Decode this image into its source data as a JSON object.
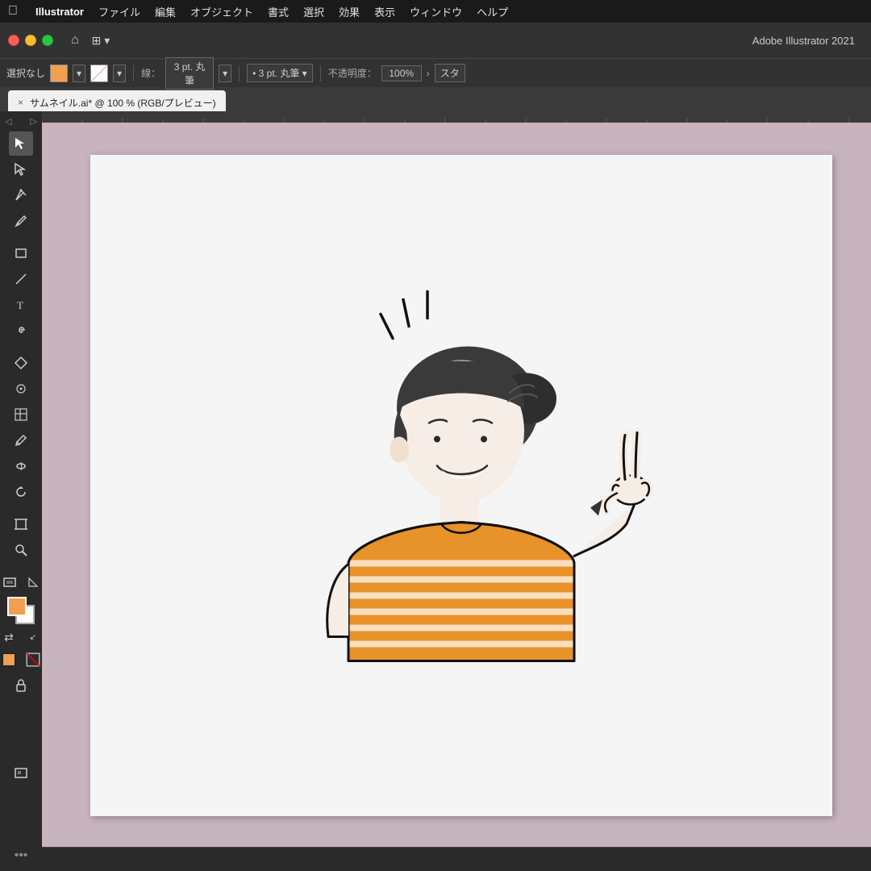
{
  "menubar": {
    "apple": "&#xF8FF;",
    "items": [
      {
        "label": "Illustrator",
        "bold": true
      },
      {
        "label": "ファイル"
      },
      {
        "label": "編集"
      },
      {
        "label": "オブジェクト"
      },
      {
        "label": "書式"
      },
      {
        "label": "選択"
      },
      {
        "label": "効果"
      },
      {
        "label": "表示"
      },
      {
        "label": "ウィンドウ"
      },
      {
        "label": "ヘルプ"
      }
    ]
  },
  "toolbar": {
    "app_title": "Adobe Illustrator 2021"
  },
  "optionsbar": {
    "selection_label": "選択なし",
    "stroke_label": "線：",
    "stroke_value": "3 pt. 丸筆",
    "opacity_label": "不透明度：",
    "opacity_value": "100%",
    "style_label": "スタ"
  },
  "tabbar": {
    "tab_label": "サムネイル.ai* @ 100 % (RGB/プレビュー)",
    "close_symbol": "×"
  },
  "tools": [
    {
      "name": "select-tool",
      "icon": "▲",
      "tooltip": "選択ツール"
    },
    {
      "name": "direct-select-tool",
      "icon": "↗",
      "tooltip": "ダイレクト選択ツール"
    },
    {
      "name": "pen-tool",
      "icon": "✒",
      "tooltip": "ペンツール"
    },
    {
      "name": "pencil-tool",
      "icon": "✏",
      "tooltip": "鉛筆ツール"
    },
    {
      "name": "rectangle-tool",
      "icon": "▭",
      "tooltip": "長方形ツール"
    },
    {
      "name": "line-tool",
      "icon": "╱",
      "tooltip": "直線ツール"
    },
    {
      "name": "text-tool",
      "icon": "T",
      "tooltip": "文字ツール"
    },
    {
      "name": "spiral-tool",
      "icon": "◎",
      "tooltip": "スパイラルツール"
    },
    {
      "name": "gradient-tool",
      "icon": "◆",
      "tooltip": "グラデーションツール"
    },
    {
      "name": "mesh-tool",
      "icon": "⊕",
      "tooltip": "メッシュツール"
    },
    {
      "name": "shape-builder-tool",
      "icon": "▣",
      "tooltip": "シェイプ形成ツール"
    },
    {
      "name": "eyedropper-tool",
      "icon": "⌗",
      "tooltip": "スポイトツール"
    },
    {
      "name": "warp-tool",
      "icon": "⋈",
      "tooltip": "ワープツール"
    },
    {
      "name": "rotate-tool",
      "icon": "↻",
      "tooltip": "回転ツール"
    },
    {
      "name": "artboard-tool",
      "icon": "⊡",
      "tooltip": "アートボードツール"
    },
    {
      "name": "zoom-tool",
      "icon": "🔍",
      "tooltip": "ズームツール"
    },
    {
      "name": "screen-mode-tool",
      "icon": "⊞",
      "tooltip": "スクリーンモード"
    },
    {
      "name": "more-tools",
      "icon": "•••",
      "tooltip": "その他のツール"
    }
  ],
  "canvas": {
    "zoom": "100%",
    "color_mode": "RGB/プレビュー"
  }
}
